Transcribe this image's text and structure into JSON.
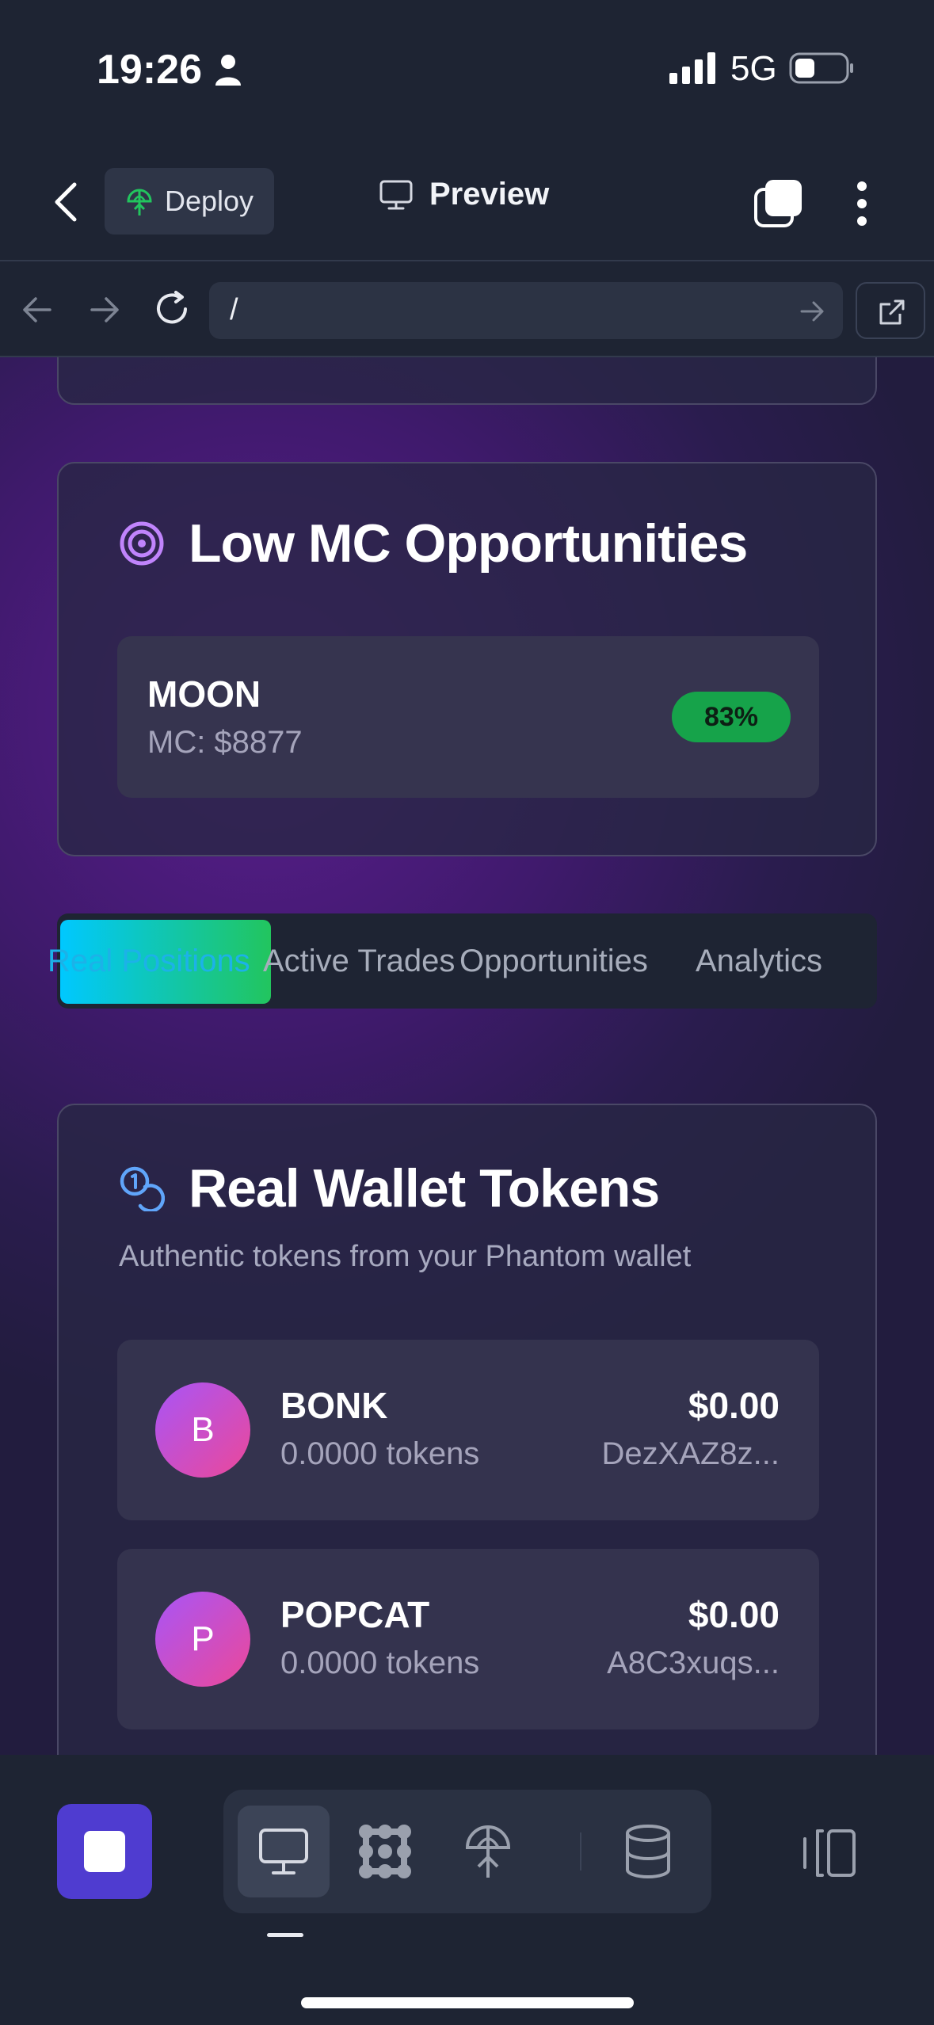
{
  "status_bar": {
    "time": "19:26",
    "network": "5G"
  },
  "header": {
    "deploy_label": "Deploy",
    "preview_label": "Preview"
  },
  "browser": {
    "url": "/"
  },
  "low_mc": {
    "title": "Low MC Opportunities",
    "items": [
      {
        "name": "MOON",
        "mc": "MC: $8877",
        "badge": "83%"
      }
    ]
  },
  "tabs": [
    {
      "label": "Real Positions",
      "active": true
    },
    {
      "label": "Active Trades",
      "active": false
    },
    {
      "label": "Opportunities",
      "active": false
    },
    {
      "label": "Analytics",
      "active": false
    }
  ],
  "wallet": {
    "title": "Real Wallet Tokens",
    "subtitle": "Authentic tokens from your Phantom wallet",
    "tokens": [
      {
        "initial": "B",
        "name": "BONK",
        "amount": "0.0000 tokens",
        "value": "$0.00",
        "address": "DezXAZ8z..."
      },
      {
        "initial": "P",
        "name": "POPCAT",
        "amount": "0.0000 tokens",
        "value": "$0.00",
        "address": "A8C3xuqs..."
      }
    ]
  },
  "colors": {
    "accent": "#4f3cd0",
    "badge_green": "#16a34a",
    "tab_gradient_start": "#00c8ff",
    "tab_gradient_end": "#22c55e"
  },
  "icons": {
    "lowmc": "target-icon",
    "wallet": "coins-icon",
    "toolbar": [
      "monitor-icon",
      "nodes-icon",
      "deploy-icon",
      "database-icon"
    ]
  }
}
